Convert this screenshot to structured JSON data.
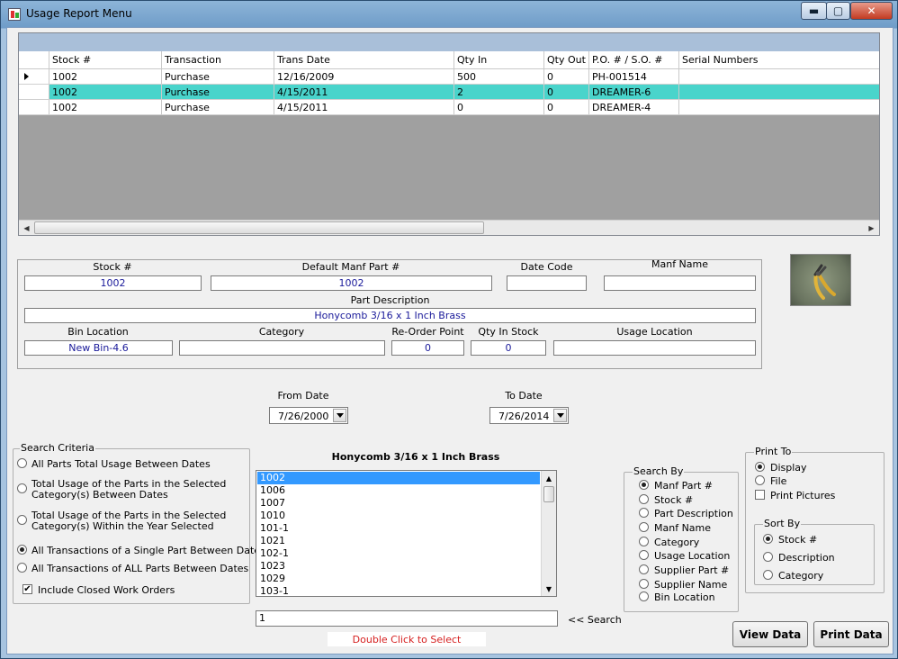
{
  "window": {
    "title": "Usage Report Menu",
    "minimize": "▬",
    "maximize": "▢",
    "close": "✕"
  },
  "grid": {
    "columns": [
      "Stock #",
      "Transaction",
      "Trans Date",
      "Qty In",
      "Qty Out",
      "P.O. # / S.O. #",
      "Serial Numbers"
    ],
    "rows": [
      {
        "stock": "1002",
        "transaction": "Purchase",
        "date": "12/16/2009",
        "qty_in": "500",
        "qty_out": "0",
        "po_so": "PH-001514",
        "serial": ""
      },
      {
        "stock": "1002",
        "transaction": "Purchase",
        "date": "4/15/2011",
        "qty_in": "2",
        "qty_out": "0",
        "po_so": "DREAMER-6",
        "serial": ""
      },
      {
        "stock": "1002",
        "transaction": "Purchase",
        "date": "4/15/2011",
        "qty_in": "0",
        "qty_out": "0",
        "po_so": "DREAMER-4",
        "serial": ""
      }
    ],
    "selected_row": 1
  },
  "detail": {
    "stock_label": "Stock #",
    "stock_value": "1002",
    "manf_part_label": "Default Manf Part #",
    "manf_part_value": "1002",
    "date_code_label": "Date Code",
    "date_code_value": "",
    "manf_name_label": "Manf Name",
    "manf_name_value": "",
    "part_desc_label": "Part Description",
    "part_desc_value": "Honycomb 3/16 x 1 Inch Brass",
    "bin_label": "Bin Location",
    "bin_value": "New Bin-4.6",
    "category_label": "Category",
    "category_value": "",
    "reorder_label": "Re-Order Point",
    "reorder_value": "0",
    "qty_stock_label": "Qty In Stock",
    "qty_stock_value": "0",
    "usage_loc_label": "Usage Location",
    "usage_loc_value": ""
  },
  "dates": {
    "from_label": "From Date",
    "from_value": "7/26/2000",
    "to_label": "To Date",
    "to_value": "7/26/2014"
  },
  "search_criteria": {
    "title": "Search Criteria",
    "options": [
      "All Parts Total Usage Between Dates",
      "Total Usage of the Parts in the Selected Category(s) Between Dates",
      "Total Usage of the Parts in the Selected Category(s) Within the Year Selected",
      "All Transactions of a Single Part Between Dates",
      "All Transactions of ALL Parts Between Dates"
    ],
    "option_lines": [
      [
        "All Parts Total Usage Between Dates"
      ],
      [
        "Total Usage of the Parts in the Selected",
        "Category(s) Between Dates"
      ],
      [
        "Total Usage of the Parts in the Selected",
        "Category(s) Within the Year Selected"
      ],
      [
        "All Transactions of a Single Part Between Dates"
      ],
      [
        "All Transactions of ALL Parts Between Dates"
      ]
    ],
    "selected": 3,
    "include_closed_label": "Include Closed Work Orders",
    "include_closed": true
  },
  "part_list": {
    "heading": "Honycomb 3/16 x 1 Inch Brass",
    "items": [
      "1002",
      "1006",
      "1007",
      "1010",
      "101-1",
      "1021",
      "102-1",
      "1023",
      "1029",
      "103-1"
    ],
    "selected": 0,
    "search_value": "1",
    "search_label": "<< Search",
    "hint": "Double Click to Select"
  },
  "search_by": {
    "title": "Search By",
    "options": [
      "Manf Part #",
      "Stock #",
      "Part Description",
      "Manf Name",
      "Category",
      "Usage Location",
      "Supplier Part #",
      "Supplier Name",
      "Bin Location"
    ],
    "selected": 0
  },
  "print_to": {
    "title": "Print To",
    "options": [
      "Display",
      "File"
    ],
    "selected": 0,
    "print_pictures_label": "Print Pictures",
    "print_pictures": false
  },
  "sort_by": {
    "title": "Sort By",
    "options": [
      "Stock #",
      "Description",
      "Category"
    ],
    "selected": 0
  },
  "buttons": {
    "view_data": "View Data",
    "print_data": "Print Data"
  },
  "colors": {
    "selected_row": "#49d4cb",
    "list_selection": "#3399ff",
    "value_text": "#1a1a9a",
    "hint_text": "#d62020"
  },
  "icons": {
    "title_icon": "app-icon",
    "row_pointer": "row-pointer-icon"
  }
}
